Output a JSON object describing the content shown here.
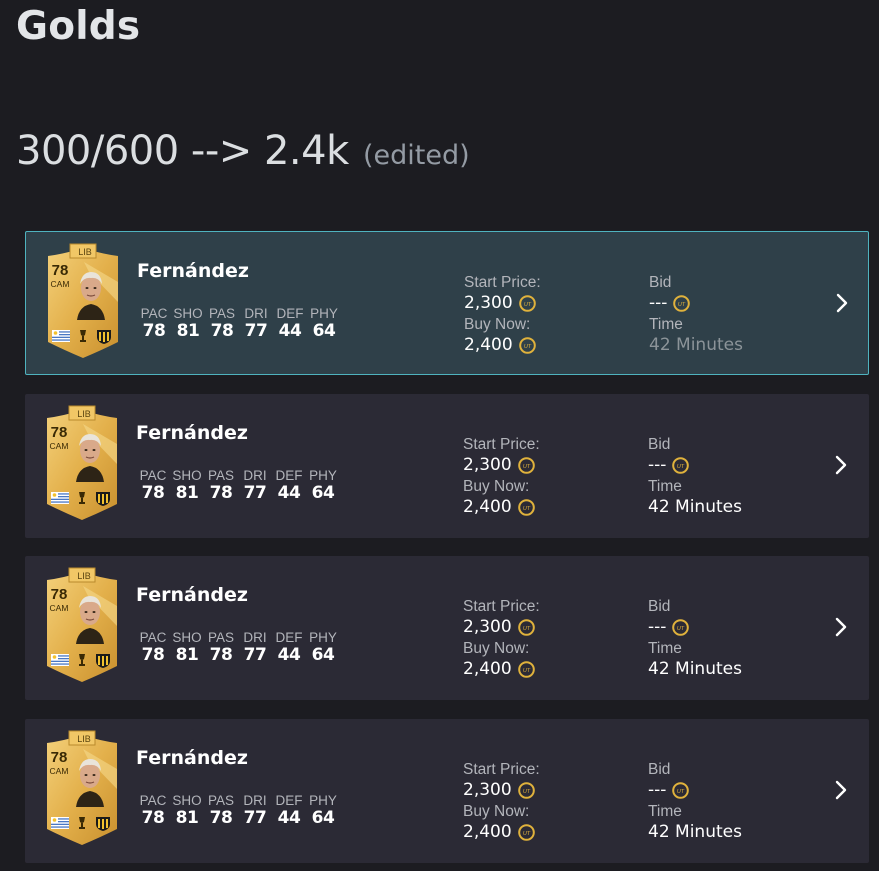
{
  "heading": "Golds",
  "message": {
    "text": "300/600 --> 2.4k",
    "edited": "(edited)"
  },
  "listings": [
    {
      "selected": true,
      "card": {
        "rating": "78",
        "position": "CAM",
        "tag": "LIB"
      },
      "name": "Fernández",
      "stats": [
        {
          "label": "PAC",
          "value": "78"
        },
        {
          "label": "SHO",
          "value": "81"
        },
        {
          "label": "PAS",
          "value": "78"
        },
        {
          "label": "DRI",
          "value": "77"
        },
        {
          "label": "DEF",
          "value": "44"
        },
        {
          "label": "PHY",
          "value": "64"
        }
      ],
      "start_price_label": "Start Price:",
      "start_price": "2,300",
      "buy_now_label": "Buy Now:",
      "buy_now": "2,400",
      "bid_label": "Bid",
      "bid": "---",
      "time_label": "Time",
      "time": "42 Minutes"
    },
    {
      "selected": false,
      "card": {
        "rating": "78",
        "position": "CAM",
        "tag": "LIB"
      },
      "name": "Fernández",
      "stats": [
        {
          "label": "PAC",
          "value": "78"
        },
        {
          "label": "SHO",
          "value": "81"
        },
        {
          "label": "PAS",
          "value": "78"
        },
        {
          "label": "DRI",
          "value": "77"
        },
        {
          "label": "DEF",
          "value": "44"
        },
        {
          "label": "PHY",
          "value": "64"
        }
      ],
      "start_price_label": "Start Price:",
      "start_price": "2,300",
      "buy_now_label": "Buy Now:",
      "buy_now": "2,400",
      "bid_label": "Bid",
      "bid": "---",
      "time_label": "Time",
      "time": "42 Minutes"
    },
    {
      "selected": false,
      "card": {
        "rating": "78",
        "position": "CAM",
        "tag": "LIB"
      },
      "name": "Fernández",
      "stats": [
        {
          "label": "PAC",
          "value": "78"
        },
        {
          "label": "SHO",
          "value": "81"
        },
        {
          "label": "PAS",
          "value": "78"
        },
        {
          "label": "DRI",
          "value": "77"
        },
        {
          "label": "DEF",
          "value": "44"
        },
        {
          "label": "PHY",
          "value": "64"
        }
      ],
      "start_price_label": "Start Price:",
      "start_price": "2,300",
      "buy_now_label": "Buy Now:",
      "buy_now": "2,400",
      "bid_label": "Bid",
      "bid": "---",
      "time_label": "Time",
      "time": "42 Minutes"
    },
    {
      "selected": false,
      "card": {
        "rating": "78",
        "position": "CAM",
        "tag": "LIB"
      },
      "name": "Fernández",
      "stats": [
        {
          "label": "PAC",
          "value": "78"
        },
        {
          "label": "SHO",
          "value": "81"
        },
        {
          "label": "PAS",
          "value": "78"
        },
        {
          "label": "DRI",
          "value": "77"
        },
        {
          "label": "DEF",
          "value": "44"
        },
        {
          "label": "PHY",
          "value": "64"
        }
      ],
      "start_price_label": "Start Price:",
      "start_price": "2,300",
      "buy_now_label": "Buy Now:",
      "buy_now": "2,400",
      "bid_label": "Bid",
      "bid": "---",
      "time_label": "Time",
      "time": "42 Minutes"
    }
  ],
  "icons": {
    "coin": "coin-icon",
    "chevron": "chevron-right-icon",
    "flag": "uruguay-flag-icon",
    "club": "club-crest-icon",
    "league": "league-trophy-icon",
    "face": "player-face-icon"
  },
  "colors": {
    "background": "#1c1c21",
    "listing_bg": "#2b2a35",
    "selected_bg": "#2f4049",
    "selected_border": "#4fb3bf",
    "gold_card": "#e3b04b"
  }
}
